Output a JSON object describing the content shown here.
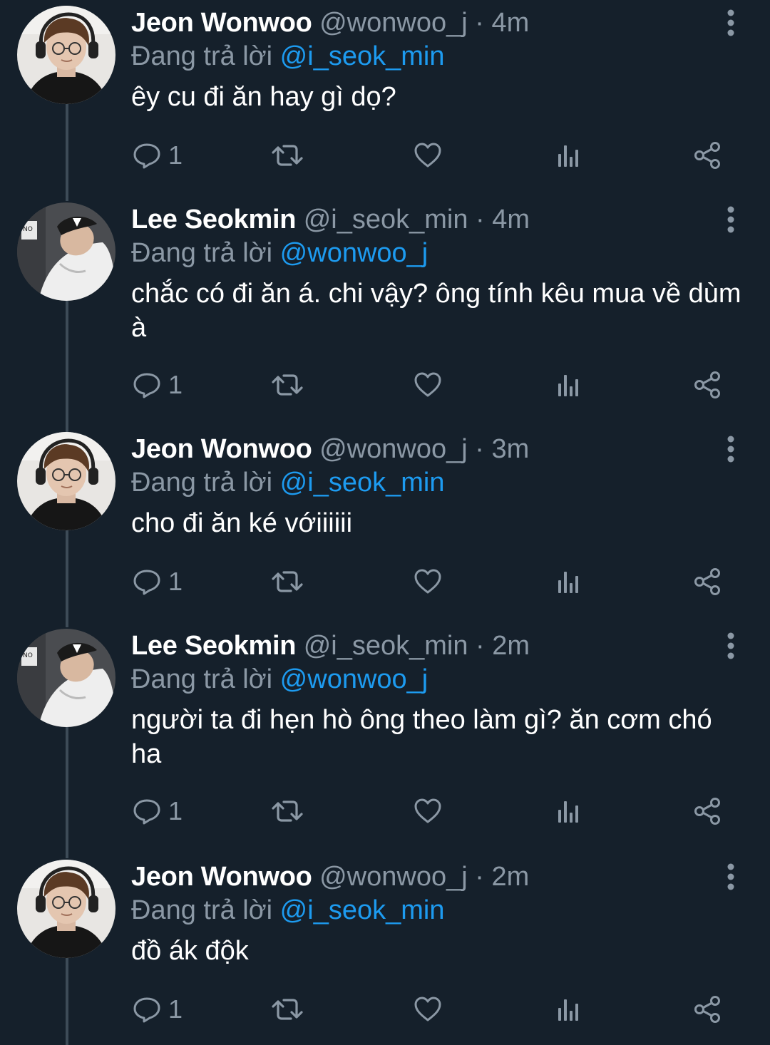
{
  "colors": {
    "background": "#15202b",
    "primary_text": "#ffffff",
    "secondary_text": "#8b98a5",
    "mention": "#1d9bf0",
    "thread_line": "#3d4b57"
  },
  "icons": {
    "more": "more-vertical-icon",
    "reply": "reply-icon",
    "retweet": "retweet-icon",
    "like": "heart-icon",
    "views": "views-icon",
    "share": "share-icon"
  },
  "tweets": [
    {
      "author": "Jeon Wonwoo",
      "handle": "@wonwoo_j",
      "separator": "·",
      "time": "4m",
      "reply_prefix": "Đang trả lời ",
      "reply_to": "@i_seok_min",
      "text": "êy cu đi ăn hay gì dọ?",
      "reply_count": "1",
      "avatar": "wonwoo"
    },
    {
      "author": "Lee Seokmin",
      "handle": "@i_seok_min",
      "separator": "·",
      "time": "4m",
      "reply_prefix": "Đang trả lời ",
      "reply_to": "@wonwoo_j",
      "text": "chắc có đi ăn á. chi vậy? ông tính kêu mua về dùm à",
      "reply_count": "1",
      "avatar": "seokmin"
    },
    {
      "author": "Jeon Wonwoo",
      "handle": "@wonwoo_j",
      "separator": "·",
      "time": "3m",
      "reply_prefix": "Đang trả lời ",
      "reply_to": "@i_seok_min",
      "text": "cho đi ăn ké vớiiiiii",
      "reply_count": "1",
      "avatar": "wonwoo"
    },
    {
      "author": "Lee Seokmin",
      "handle": "@i_seok_min",
      "separator": "·",
      "time": "2m",
      "reply_prefix": "Đang trả lời ",
      "reply_to": "@wonwoo_j",
      "text": "người ta đi hẹn hò ông theo làm gì? ăn cơm chó ha",
      "reply_count": "1",
      "avatar": "seokmin"
    },
    {
      "author": "Jeon Wonwoo",
      "handle": "@wonwoo_j",
      "separator": "·",
      "time": "2m",
      "reply_prefix": "Đang trả lời ",
      "reply_to": "@i_seok_min",
      "text": "đồ ák độk",
      "reply_count": "1",
      "avatar": "wonwoo"
    }
  ]
}
